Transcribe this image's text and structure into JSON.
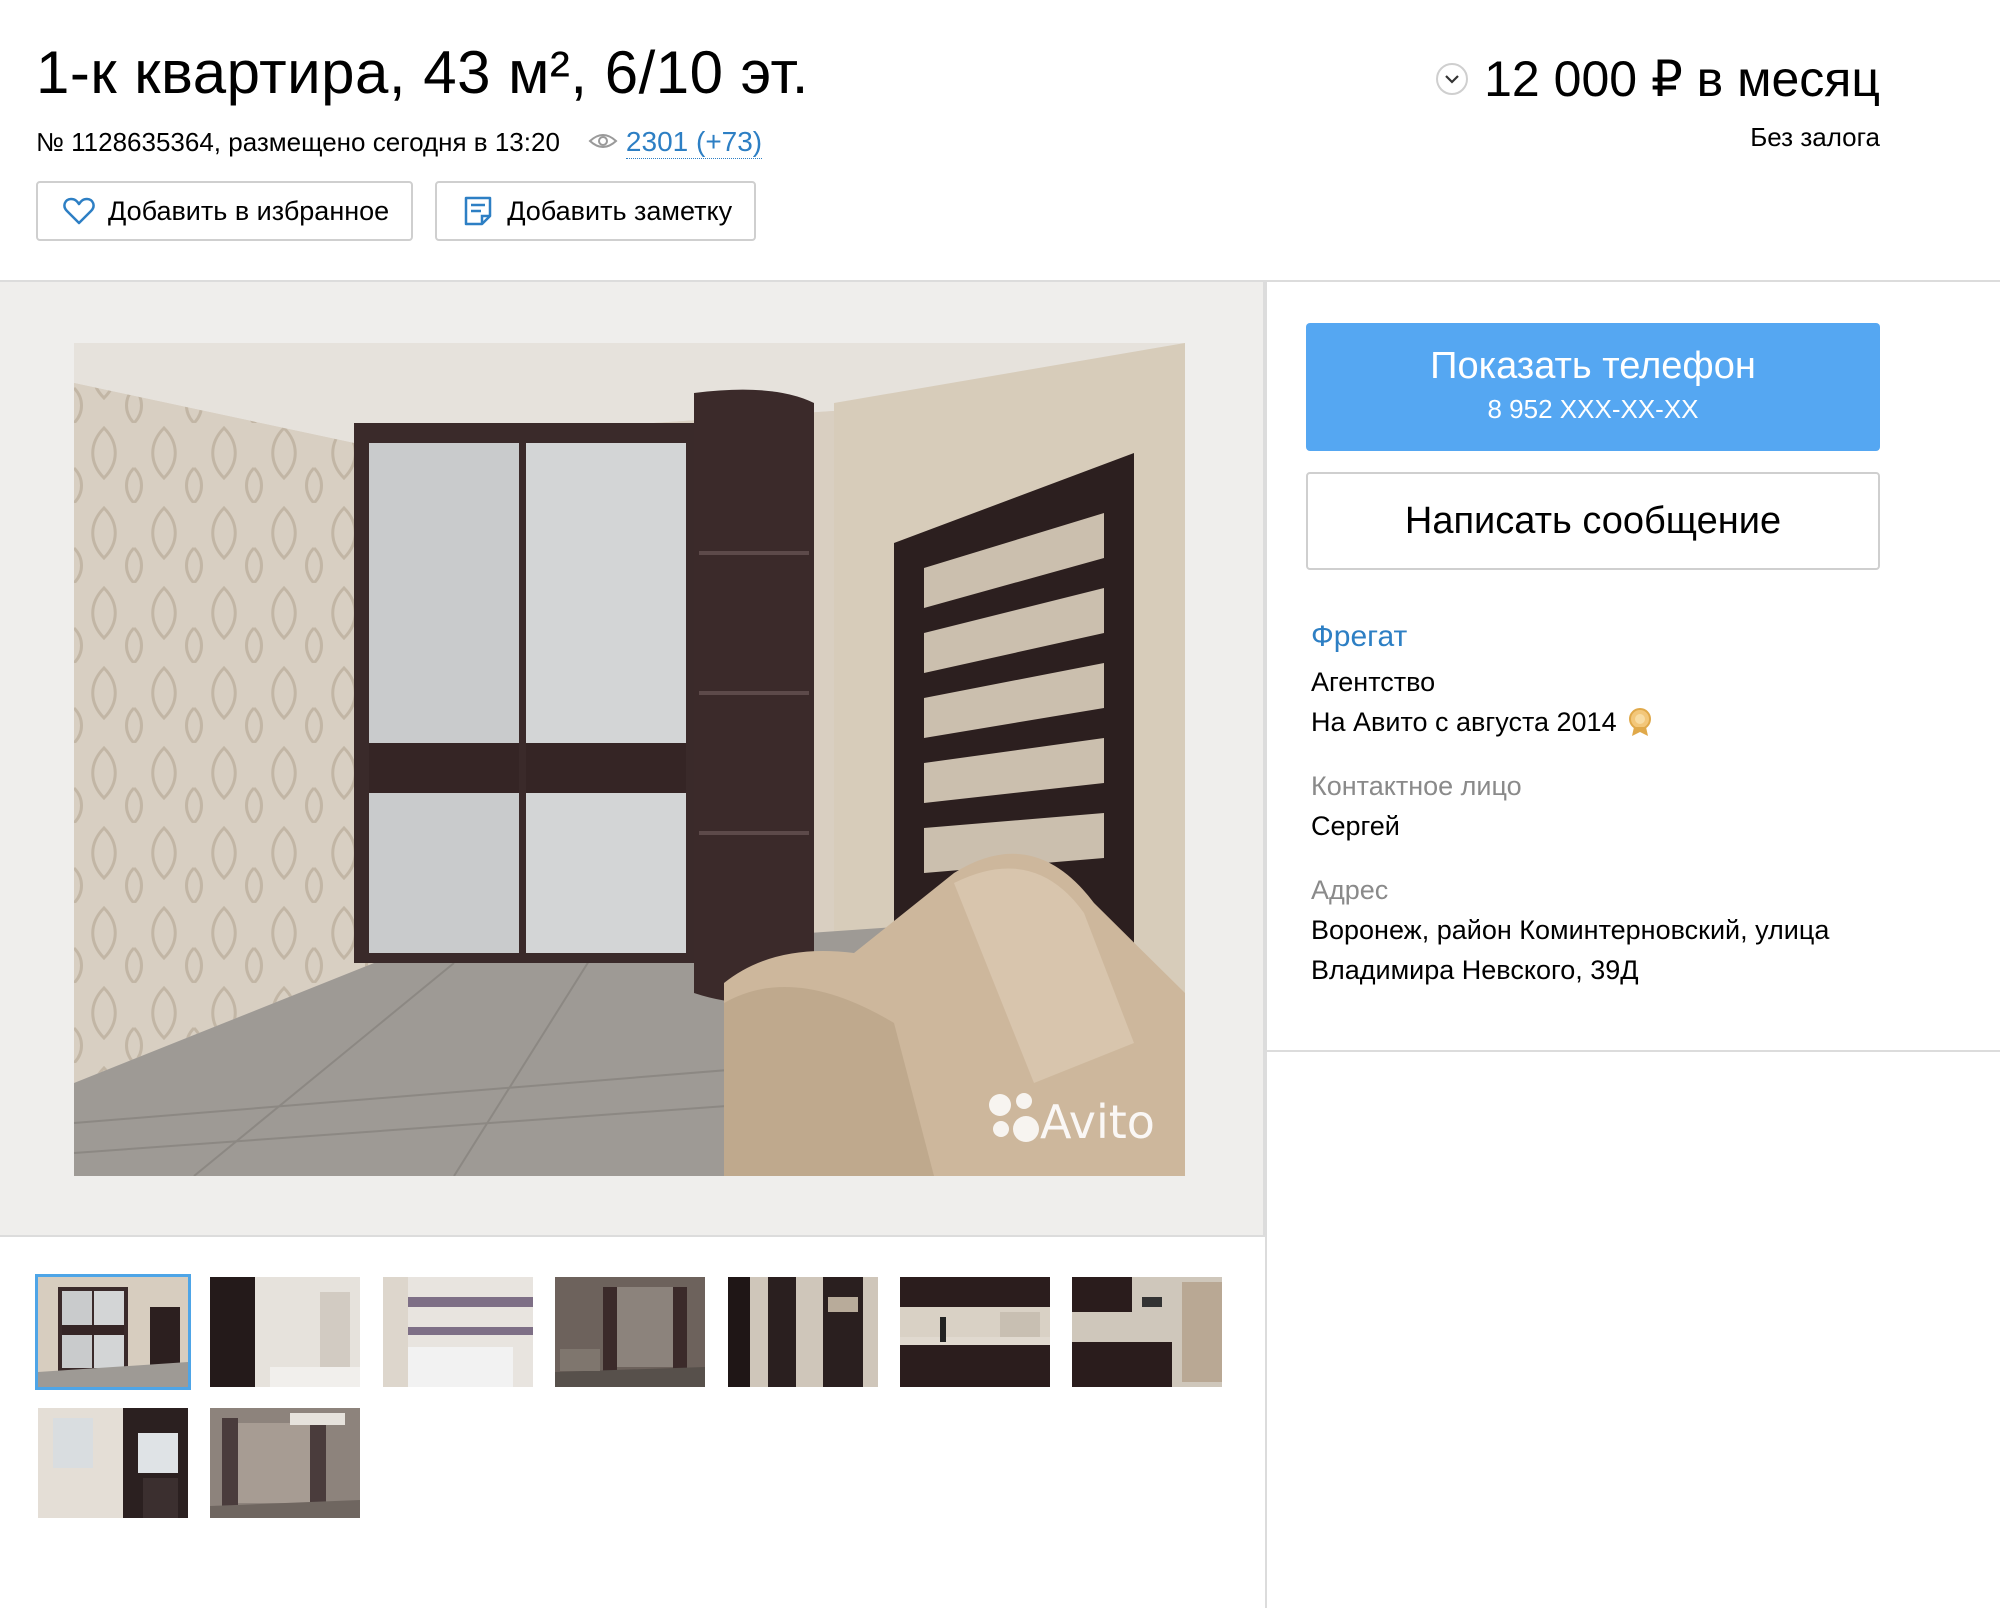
{
  "listing": {
    "title": "1-к квартира, 43 м², 6/10 эт.",
    "number_posted": "№ 1128635364, размещено сегодня в 13:20",
    "views": "2301 (+73)",
    "price": "12 000 ₽ в месяц",
    "deposit": "Без залога"
  },
  "actions": {
    "favorite_label": "Добавить в избранное",
    "note_label": "Добавить заметку"
  },
  "contact": {
    "phone_title": "Показать телефон",
    "phone_mask": "8 952 XXX-XX-XX",
    "message_label": "Написать сообщение"
  },
  "seller": {
    "name": "Фрегат",
    "type": "Агентство",
    "since": "На Авито с августа 2014",
    "contact_label": "Контактное лицо",
    "contact_name": "Сергей",
    "address_label": "Адрес",
    "address_line1": "Воронеж, район Коминтерновский, улица",
    "address_line2": "Владимира Невского, 39Д"
  },
  "gallery": {
    "watermark": "Avito",
    "thumbnail_count": 9,
    "active_thumbnail": 1
  },
  "colors": {
    "accent_blue": "#55a7f2",
    "link_blue": "#2d7fc4",
    "border_gray": "#cfcfcf",
    "label_gray": "#8a8a8a"
  }
}
